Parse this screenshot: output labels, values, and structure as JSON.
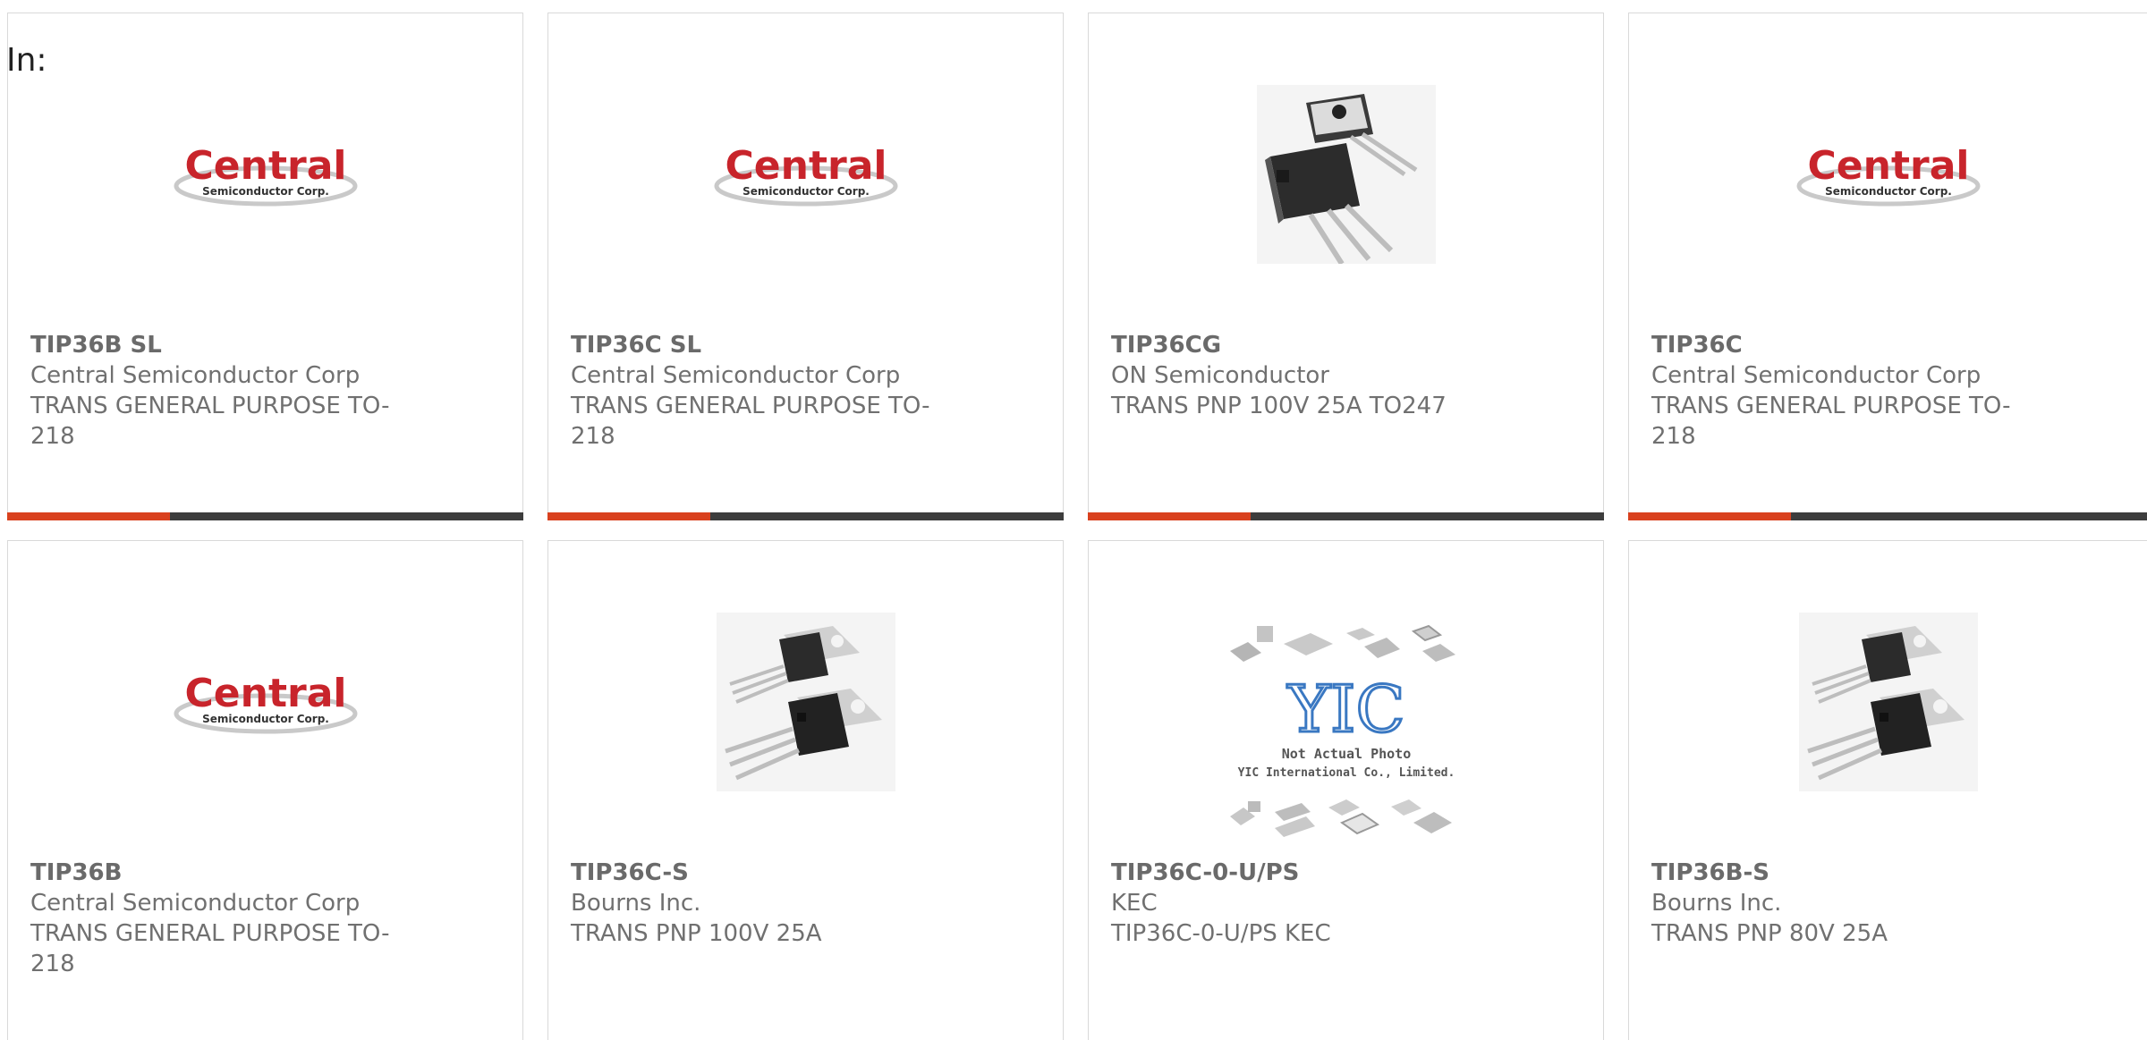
{
  "header": {
    "in_label": "In:"
  },
  "logo_texts": {
    "central": "Central",
    "semi": "Semiconductor Corp.",
    "yic_main": "YIC",
    "yic_line1": "Not Actual Photo",
    "yic_line2": "YIC International Co., Limited."
  },
  "colors": {
    "accent": "#d9411e",
    "bar_dark": "#3d3d3d",
    "text": "#707070",
    "central_red": "#c8242b"
  },
  "products": [
    {
      "part": "TIP36B SL",
      "mfr": "Central Semiconductor Corp",
      "desc1": "TRANS GENERAL PURPOSE TO-",
      "desc2": "218",
      "image": "central-logo"
    },
    {
      "part": "TIP36C SL",
      "mfr": "Central Semiconductor Corp",
      "desc1": "TRANS GENERAL PURPOSE TO-",
      "desc2": "218",
      "image": "central-logo"
    },
    {
      "part": "TIP36CG",
      "mfr": "ON Semiconductor",
      "desc1": "TRANS PNP 100V 25A TO247",
      "desc2": "",
      "image": "to247-transistor"
    },
    {
      "part": "TIP36C",
      "mfr": "Central Semiconductor Corp",
      "desc1": "TRANS GENERAL PURPOSE TO-",
      "desc2": "218",
      "image": "central-logo"
    },
    {
      "part": "TIP36B",
      "mfr": "Central Semiconductor Corp",
      "desc1": "TRANS GENERAL PURPOSE TO-",
      "desc2": "218",
      "image": "central-logo"
    },
    {
      "part": "TIP36C-S",
      "mfr": "Bourns Inc.",
      "desc1": "TRANS PNP 100V 25A",
      "desc2": "",
      "image": "to220-transistor"
    },
    {
      "part": "TIP36C-0-U/PS",
      "mfr": "KEC",
      "desc1": "TIP36C-0-U/PS KEC",
      "desc2": "",
      "image": "yic-placeholder"
    },
    {
      "part": "TIP36B-S",
      "mfr": "Bourns Inc.",
      "desc1": "TRANS PNP 80V 25A",
      "desc2": "",
      "image": "to220-transistor"
    }
  ]
}
